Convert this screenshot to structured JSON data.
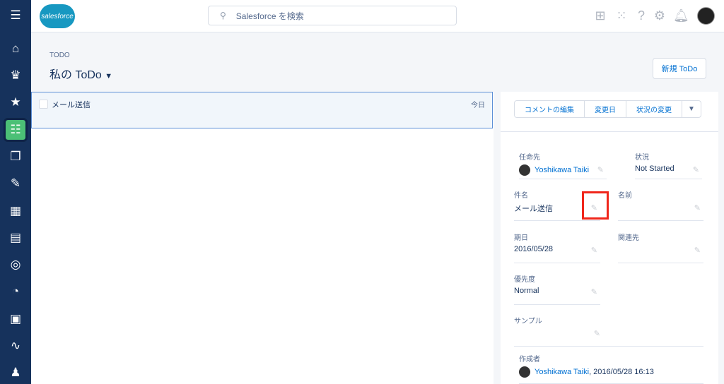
{
  "sidebar": {
    "items": [
      "menu-icon",
      "home-icon",
      "crown-icon",
      "person-star-icon",
      "tasks-icon",
      "files-icon",
      "notes-icon",
      "building-icon",
      "contact-card-icon",
      "target-icon",
      "gauge-icon",
      "clipboard-icon",
      "pulse-icon",
      "people-icon"
    ],
    "active": "tasks-icon",
    "active_color": "#4bc076"
  },
  "header": {
    "logo": "salesforce",
    "search_placeholder": "Salesforce を検索"
  },
  "page": {
    "object_label": "TODO",
    "title": "私の ToDo",
    "new_button": "新規 ToDo"
  },
  "list": {
    "items": [
      {
        "subject": "メール送信",
        "date": "今日"
      }
    ]
  },
  "detail": {
    "actions": [
      "コメントの編集",
      "変更日",
      "状況の変更"
    ],
    "fields": {
      "assignee": {
        "label": "任命先",
        "value": "Yoshikawa Taiki"
      },
      "status": {
        "label": "状況",
        "value": "Not Started"
      },
      "subject": {
        "label": "件名",
        "value": "メール送信"
      },
      "name": {
        "label": "名前",
        "value": ""
      },
      "due": {
        "label": "期日",
        "value": "2016/05/28"
      },
      "related": {
        "label": "関連先",
        "value": ""
      },
      "priority": {
        "label": "優先度",
        "value": "Normal"
      },
      "sample": {
        "label": "サンプル",
        "value": ""
      },
      "created": {
        "label": "作成者",
        "user": "Yoshikawa Taiki",
        "datetime": ", 2016/05/28 16:13"
      }
    }
  },
  "highlight_color": "#f0261b"
}
